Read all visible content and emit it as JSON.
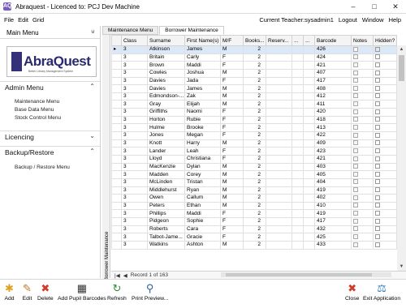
{
  "window": {
    "title": "Abraquest - Licenced to: PCJ Dev Machine",
    "app_icon": "AQ"
  },
  "menu": {
    "items": [
      "File",
      "Edit",
      "Grid"
    ],
    "teacher": "Current Teacher:sysadmin1",
    "logout": "Logout",
    "window": "Window",
    "help": "Help"
  },
  "left_panel": {
    "title": "Main Menu",
    "logo": {
      "brand": "AbraQuest",
      "tagline": "Better Library Management System"
    },
    "sections": [
      {
        "label": "Admin Menu",
        "links": [
          "Maintenance Menu",
          "Base Data Menu",
          "Stock Control Menu"
        ]
      },
      {
        "label": "Licencing",
        "links": []
      },
      {
        "label": "Backup/Restore",
        "links": [
          "Backup / Restore Menu"
        ]
      }
    ]
  },
  "tabs": [
    "Maintenance Menu",
    "Borrower Maintenance"
  ],
  "vertical_label": "Borrower Maintenance",
  "grid": {
    "columns": [
      "",
      "Class",
      "Surname",
      "First Name(s)",
      "M/F",
      "Books...",
      "Reserv...",
      "...",
      "...",
      "Barcode",
      "Notes",
      "Hidden?"
    ],
    "rows": [
      [
        "3",
        "Atkinson",
        "James",
        "M",
        "2",
        "426"
      ],
      [
        "3",
        "Britain",
        "Carly",
        "F",
        "2",
        "424"
      ],
      [
        "3",
        "Brown",
        "Maddi",
        "F",
        "2",
        "421"
      ],
      [
        "3",
        "Cowles",
        "Joshua",
        "M",
        "2",
        "407"
      ],
      [
        "3",
        "Davies",
        "Jada",
        "F",
        "2",
        "417"
      ],
      [
        "3",
        "Davies",
        "James",
        "M",
        "2",
        "408"
      ],
      [
        "3",
        "Edmondson-...",
        "Zak",
        "M",
        "2",
        "412"
      ],
      [
        "3",
        "Gray",
        "Elijah",
        "M",
        "2",
        "411"
      ],
      [
        "3",
        "Griffiths",
        "Naomi",
        "F",
        "2",
        "420"
      ],
      [
        "3",
        "Horton",
        "Rubie",
        "F",
        "2",
        "418"
      ],
      [
        "3",
        "Hulme",
        "Brooke",
        "F",
        "2",
        "413"
      ],
      [
        "3",
        "Jones",
        "Megan",
        "F",
        "2",
        "422"
      ],
      [
        "3",
        "Knott",
        "Harry",
        "M",
        "2",
        "409"
      ],
      [
        "3",
        "Lander",
        "Leah",
        "F",
        "2",
        "423"
      ],
      [
        "3",
        "Lloyd",
        "Christiana",
        "F",
        "2",
        "421"
      ],
      [
        "3",
        "MacKenzie",
        "Dylan",
        "M",
        "2",
        "403"
      ],
      [
        "3",
        "Madden",
        "Corey",
        "M",
        "2",
        "405"
      ],
      [
        "3",
        "McLinden",
        "Tristan",
        "M",
        "2",
        "404"
      ],
      [
        "3",
        "Middlehurst",
        "Ryan",
        "M",
        "2",
        "419"
      ],
      [
        "3",
        "Owen",
        "Callum",
        "M",
        "2",
        "402"
      ],
      [
        "3",
        "Peters",
        "Ethan",
        "M",
        "2",
        "410"
      ],
      [
        "3",
        "Phillips",
        "Maddi",
        "F",
        "2",
        "419"
      ],
      [
        "3",
        "Pidgeon",
        "Sophie",
        "F",
        "2",
        "417"
      ],
      [
        "3",
        "Roberts",
        "Cara",
        "F",
        "2",
        "432"
      ],
      [
        "3",
        "Talbot-Jame...",
        "Gracie",
        "F",
        "2",
        "425"
      ],
      [
        "3",
        "Watkins",
        "Ashton",
        "M",
        "2",
        "433"
      ]
    ]
  },
  "navigator": {
    "record_text": "Record 1 of 163"
  },
  "toolbar": {
    "add": "Add",
    "edit": "Edit",
    "delete": "Delete",
    "add_pupil_barcodes": "Add Pupil Barcodes",
    "refresh": "Refresh",
    "print_preview": "Print Preview...",
    "close": "Close",
    "exit": "Exit Application"
  },
  "colors": {
    "selection": "#dbe8f7",
    "logo_dark": "#2a2a6e",
    "close_red": "#d23a2a"
  }
}
